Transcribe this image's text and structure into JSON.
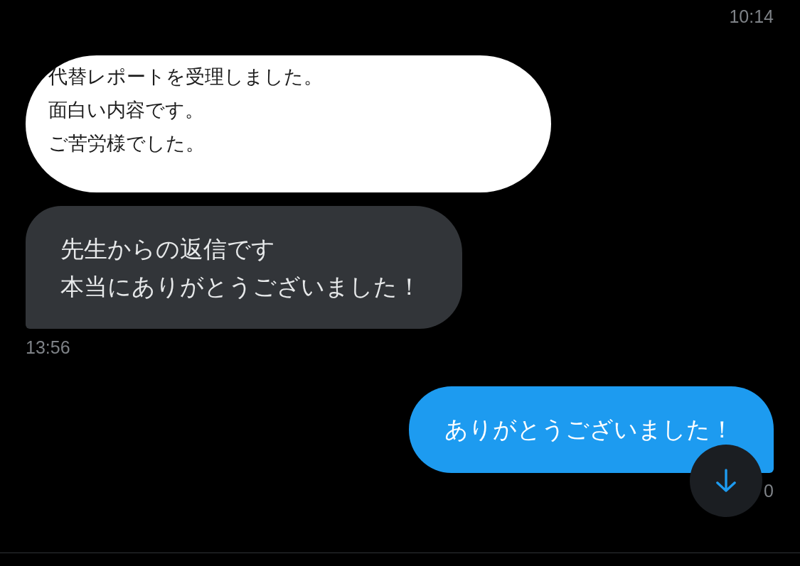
{
  "top_time": "10:14",
  "messages": [
    {
      "kind": "image",
      "lines": [
        "代替レポートを受理しました。",
        "面白い内容です。",
        "ご苦労様でした。"
      ]
    },
    {
      "kind": "received",
      "lines": [
        "先生からの返信です",
        "本当にありがとうございました！"
      ],
      "time": "13:56"
    },
    {
      "kind": "sent",
      "lines": [
        "ありがとうございました！"
      ],
      "time": "0"
    }
  ]
}
